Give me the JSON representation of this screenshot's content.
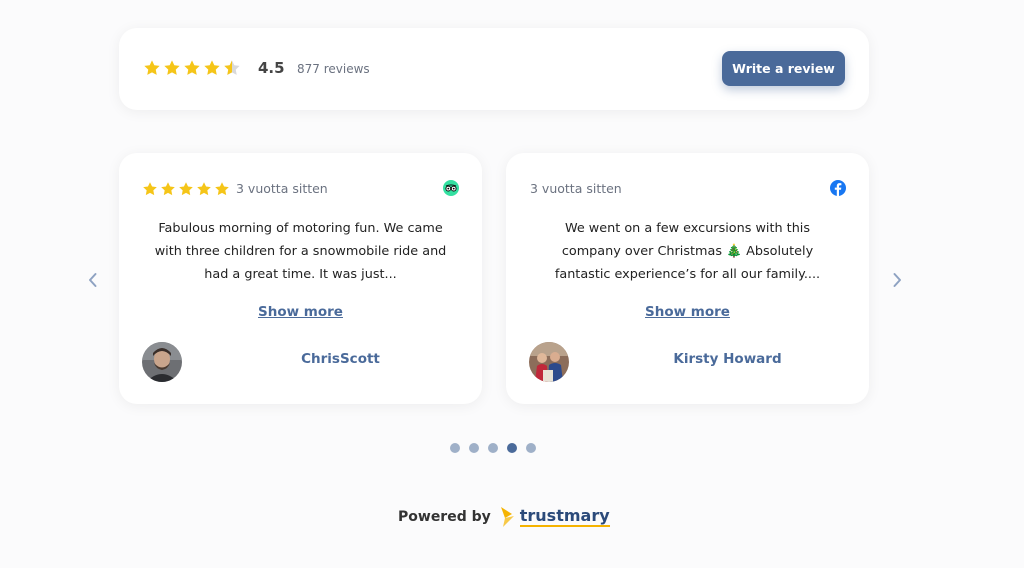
{
  "summary": {
    "rating_value": "4.5",
    "rating": 4.5,
    "review_count": "877 reviews",
    "write_review_label": "Write a review"
  },
  "reviews": [
    {
      "rating": 5,
      "time": "3 vuotta sitten",
      "source_icon": "tripadvisor-icon",
      "text": "Fabulous morning of motoring fun. We came with three children for a snowmobile ride and had a great time. It was just...",
      "show_more": "Show more",
      "author": "ChrisScott"
    },
    {
      "rating": 0,
      "time": "3 vuotta sitten",
      "source_icon": "facebook-icon",
      "text": "We went on a few excursions with this company over Christmas 🎄 Absolutely fantastic experience’s for all our family....",
      "show_more": "Show more",
      "author": "Kirsty Howard"
    }
  ],
  "carousel": {
    "page_count": 5,
    "active_index": 3
  },
  "footer": {
    "powered_by": "Powered by",
    "brand": "trustmary"
  },
  "colors": {
    "accent": "#4a6a9a",
    "star": "#f5c518",
    "star_empty": "#d9d9d9",
    "tripadvisor": "#34e0a1",
    "facebook": "#1877f2",
    "brand_yellow": "#f5b300"
  }
}
